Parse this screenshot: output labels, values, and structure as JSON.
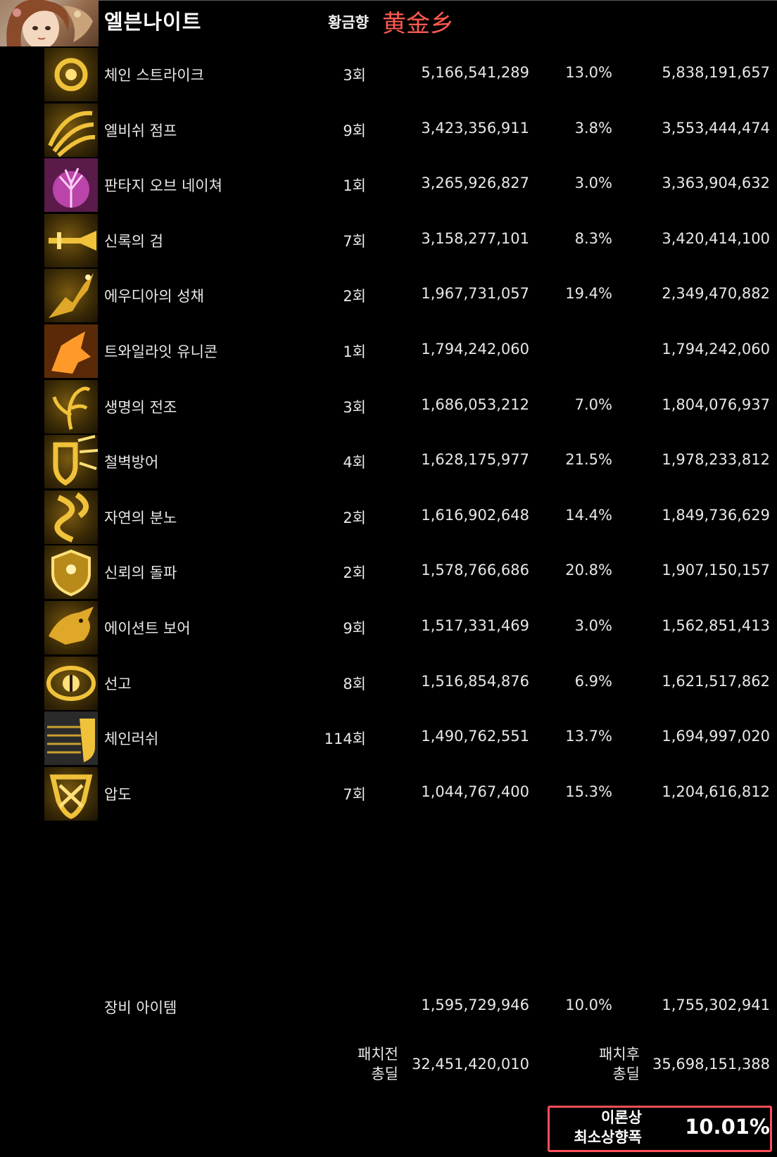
{
  "header": {
    "character_name": "엘븐나이트",
    "server_label": "황금향",
    "guild_name": "黄金乡"
  },
  "skills": [
    {
      "name": "체인 스트라이크",
      "count": "3회",
      "damage": "5,166,541,289",
      "increase": "13.0%",
      "total": "5,838,191,657",
      "icon": "chain-strike-icon"
    },
    {
      "name": "엘비쉬 점프",
      "count": "9회",
      "damage": "3,423,356,911",
      "increase": "3.8%",
      "total": "3,553,444,474",
      "icon": "elvish-jump-icon"
    },
    {
      "name": "판타지 오브 네이쳐",
      "count": "1회",
      "damage": "3,265,926,827",
      "increase": "3.0%",
      "total": "3,363,904,632",
      "icon": "fantasy-of-nature-icon"
    },
    {
      "name": "신록의 검",
      "count": "7회",
      "damage": "3,158,277,101",
      "increase": "8.3%",
      "total": "3,420,414,100",
      "icon": "verdant-sword-icon"
    },
    {
      "name": "에우디아의 성채",
      "count": "2회",
      "damage": "1,967,731,057",
      "increase": "19.4%",
      "total": "2,349,470,882",
      "icon": "eudia-fortress-icon"
    },
    {
      "name": "트와일라잇 유니콘",
      "count": "1회",
      "damage": "1,794,242,060",
      "increase": "",
      "total": "1,794,242,060",
      "icon": "twilight-unicorn-icon"
    },
    {
      "name": "생명의 전조",
      "count": "3회",
      "damage": "1,686,053,212",
      "increase": "7.0%",
      "total": "1,804,076,937",
      "icon": "omen-of-life-icon"
    },
    {
      "name": "철벽방어",
      "count": "4회",
      "damage": "1,628,175,977",
      "increase": "21.5%",
      "total": "1,978,233,812",
      "icon": "iron-wall-icon"
    },
    {
      "name": "자연의 분노",
      "count": "2회",
      "damage": "1,616,902,648",
      "increase": "14.4%",
      "total": "1,849,736,629",
      "icon": "nature-fury-icon"
    },
    {
      "name": "신뢰의 돌파",
      "count": "2회",
      "damage": "1,578,766,686",
      "increase": "20.8%",
      "total": "1,907,150,157",
      "icon": "trust-breakthrough-icon"
    },
    {
      "name": "에이션트 보어",
      "count": "9회",
      "damage": "1,517,331,469",
      "increase": "3.0%",
      "total": "1,562,851,413",
      "icon": "ancient-boar-icon"
    },
    {
      "name": "선고",
      "count": "8회",
      "damage": "1,516,854,876",
      "increase": "6.9%",
      "total": "1,621,517,862",
      "icon": "sentence-icon"
    },
    {
      "name": "체인러쉬",
      "count": "114회",
      "damage": "1,490,762,551",
      "increase": "13.7%",
      "total": "1,694,997,020",
      "icon": "chain-rush-icon"
    },
    {
      "name": "압도",
      "count": "7회",
      "damage": "1,044,767,400",
      "increase": "15.3%",
      "total": "1,204,616,812",
      "icon": "overwhelm-icon"
    }
  ],
  "equipment": {
    "name": "장비 아이템",
    "damage": "1,595,729,946",
    "increase": "10.0%",
    "total": "1,755,302,941"
  },
  "summary": {
    "pre_label_1": "패치전",
    "pre_label_2": "총딜",
    "pre_value": "32,451,420,010",
    "post_label_1": "패치후",
    "post_label_2": "총딜",
    "post_value": "35,698,151,388"
  },
  "result": {
    "label_1": "이론상",
    "label_2": "최소상향폭",
    "value": "10.01%",
    "highlight_color": "#ff4f5a"
  },
  "colors": {
    "background": "#000000",
    "text": "#e8e8e8",
    "guild": "#ff5a50",
    "icon_gold": "#e8b830"
  }
}
